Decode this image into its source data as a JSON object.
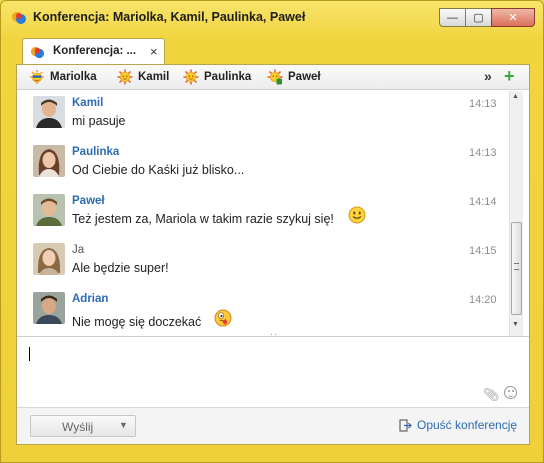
{
  "window": {
    "title": "Konferencja: Mariolka, Kamil, Paulinka, Paweł",
    "minimize_glyph": "—",
    "maximize_glyph": "▢",
    "close_glyph": "✕"
  },
  "tab": {
    "label": "Konferencja: ...",
    "close_glyph": "×"
  },
  "participants": [
    {
      "name": "Mariolka",
      "icon": "sun-sunglasses-icon"
    },
    {
      "name": "Kamil",
      "icon": "sun-icon"
    },
    {
      "name": "Paulinka",
      "icon": "sun-icon"
    },
    {
      "name": "Paweł",
      "icon": "sun-mobile-icon"
    }
  ],
  "participants_more_glyph": "»",
  "participants_add_glyph": "+",
  "messages": [
    {
      "sender": "Kamil",
      "text": "mi pasuje",
      "time": "14:13"
    },
    {
      "sender": "Paulinka",
      "text": "Od Ciebie do Kaśki już blisko...",
      "time": "14:13"
    },
    {
      "sender": "Paweł",
      "text": "Też jestem za, Mariola w takim razie szykuj się!",
      "time": "14:14",
      "emoji": "smile-emoji"
    },
    {
      "sender": "Ja",
      "text": "Ale będzie super!",
      "time": "14:15"
    },
    {
      "sender": "Adrian",
      "text": "Nie mogę się doczekać",
      "time": "14:20",
      "emoji": "tongue-emoji"
    }
  ],
  "input": {
    "value": ""
  },
  "footer": {
    "send_label": "Wyślij",
    "send_arrow": "▼",
    "leave_label": "Opuść konferencję"
  },
  "colors": {
    "window_frame": "#f1d43e",
    "link_blue": "#2b6cb3",
    "timestamp_gray": "#8d8d8d"
  }
}
